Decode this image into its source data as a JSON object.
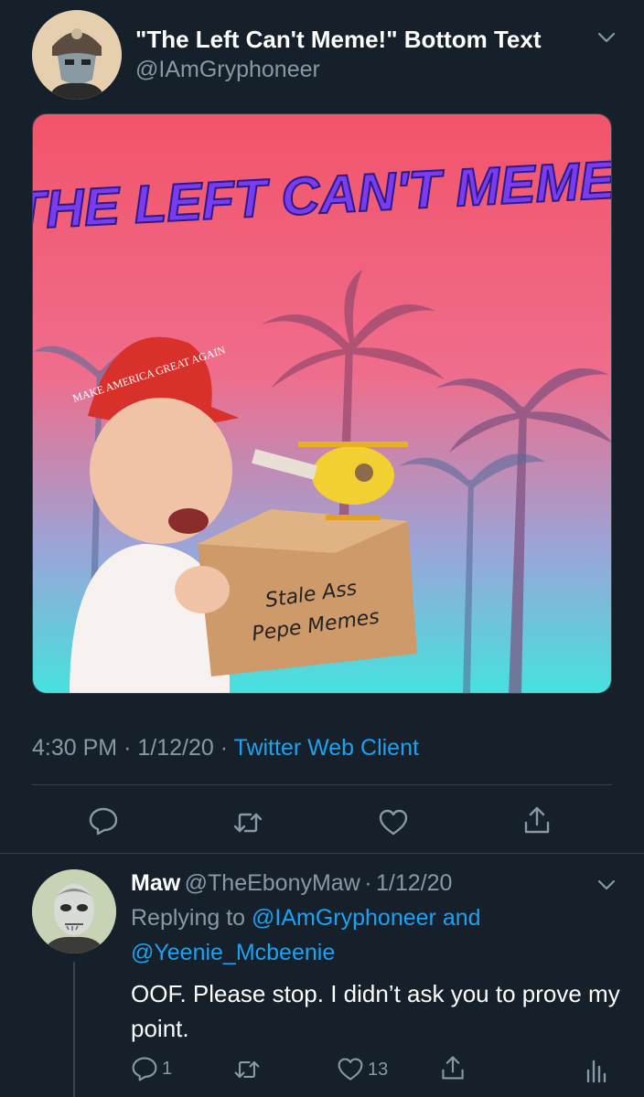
{
  "tweet": {
    "display_name": "\"The Left Can't Meme!\" Bottom Text",
    "handle": "@IAmGryphoneer",
    "meme": {
      "caption": "\"THE LEFT CAN'T MEME!\"",
      "hat_text": "MAKE AMERICA GREAT AGAIN",
      "box_text_line1": "Stale Ass",
      "box_text_line2": "Pepe Memes"
    },
    "time": "4:30 PM",
    "date": "1/12/20",
    "source": "Twitter Web Client",
    "dot": "·",
    "actions": [
      "reply-icon",
      "retweet-icon",
      "like-icon",
      "share-icon"
    ]
  },
  "reply": {
    "display_name": "Maw",
    "handle": "@TheEbonyMaw",
    "date": "1/12/20",
    "dot": "·",
    "replying_prefix": "Replying to",
    "replying_to_1": "@IAmGryphoneer",
    "replying_and": "and",
    "replying_to_2": "@Yeenie_Mcbeenie",
    "text": "OOF. Please stop. I didn’t ask you to prove my point.",
    "reply_count": "1",
    "like_count": "13"
  },
  "colors": {
    "background": "#15202b",
    "secondary_text": "#8899a6",
    "link": "#1da1f2",
    "divider": "#38444d"
  }
}
